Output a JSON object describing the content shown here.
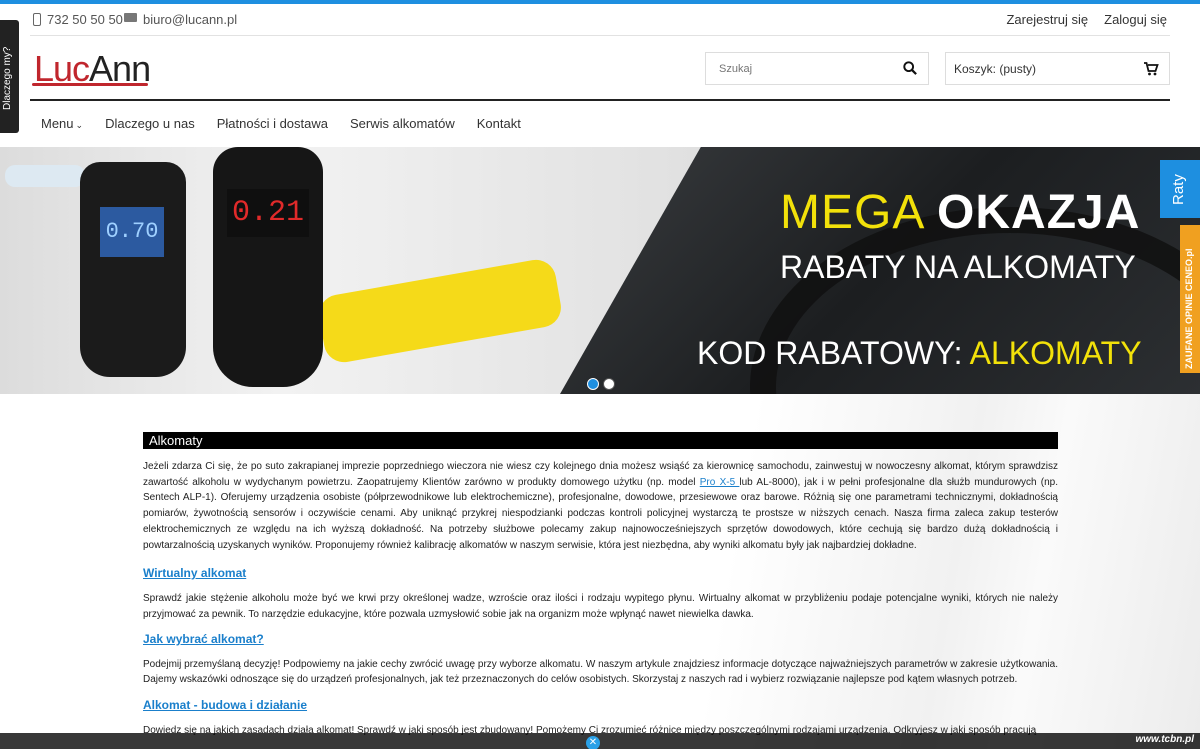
{
  "topbar": {
    "phone": "732 50 50 50",
    "email": "biuro@lucann.pl",
    "register": "Zarejestruj się",
    "login": "Zaloguj się"
  },
  "side_tab": "Dlaczego my?",
  "logo": {
    "part1": "Luc",
    "part2": "Ann"
  },
  "search": {
    "placeholder": "Szukaj"
  },
  "cart": {
    "label": "Koszyk:",
    "value": "(pusty)"
  },
  "nav": {
    "menu": "Menu",
    "items": [
      "Dlaczego u nas",
      "Płatności i dostawa",
      "Serwis alkomatów",
      "Kontakt"
    ]
  },
  "banner": {
    "line1_a": "MEGA",
    "line1_b": "OKAZJA",
    "line2": "RABATY NA ALKOMATY",
    "line3_a": "KOD RABATOWY:",
    "line3_b": "ALKOMATY",
    "dev1_display": "0.70",
    "dev2_display": "0.21"
  },
  "raty": "Raty",
  "ceneo": "ZAUFANE OPINIE CENEO.pl",
  "content": {
    "heading": "Alkomaty",
    "intro_a": "Jeżeli zdarza Ci się, że po suto zakrapianej imprezie poprzedniego wieczora nie wiesz czy kolejnego dnia możesz wsiąść za kierownicę samochodu, zainwestuj w nowoczesny alkomat, którym sprawdzisz zawartość alkoholu w wydychanym powietrzu. Zaopatrujemy Klientów zarówno w produkty domowego użytku (np. model ",
    "intro_link": "Pro X-5 ",
    "intro_b": "lub AL-8000), jak i w pełni profesjonalne dla służb mundurowych (np. Sentech ALP-1). Oferujemy urządzenia osobiste (półprzewodnikowe lub elektrochemiczne), profesjonalne, dowodowe, przesiewowe oraz barowe. Różnią się one parametrami technicznymi, dokładnością pomiarów, żywotnością sensorów i oczywiście cenami. Aby uniknąć przykrej niespodzianki podczas kontroli policyjnej wystarczą te prostsze w niższych cenach. Nasza firma zaleca zakup testerów elektrochemicznych ze względu na ich wyższą dokładność. Na potrzeby służbowe polecamy zakup najnowocześniejszych sprzętów dowodowych, które cechują się bardzo dużą dokładnością i powtarzalnością uzyskanych wyników. Proponujemy również kalibrację alkomatów w naszym serwisie, która jest niezbędna, aby wyniki alkomatu były jak najbardziej dokładne.",
    "sections": [
      {
        "title": "Wirtualny alkomat",
        "text": "Sprawdź jakie stężenie alkoholu może być we krwi przy określonej wadze, wzroście oraz ilości i rodzaju wypitego płynu. Wirtualny alkomat w przybliżeniu podaje potencjalne wyniki, których nie należy przyjmować za pewnik. To narzędzie edukacyjne, które pozwala uzmysłowić sobie jak na organizm może wpłynąć nawet niewielka dawka."
      },
      {
        "title": "Jak wybrać alkomat?",
        "text": "Podejmij przemyślaną decyzję! Podpowiemy na jakie cechy zwrócić uwagę przy wyborze alkomatu. W naszym artykule znajdziesz informacje dotyczące najważniejszych parametrów w zakresie użytkowania. Dajemy wskazówki odnoszące się do urządzeń profesjonalnych, jak też przeznaczonych do celów osobistych. Skorzystaj z naszych rad i wybierz rozwiązanie najlepsze pod kątem własnych potrzeb."
      },
      {
        "title": "Alkomat - budowa i działanie",
        "text": "Dowiedz się na jakich zasadach działa alkomat! Sprawdź w jaki sposób jest zbudowany! Pomożemy Ci zrozumieć różnice między poszczególnymi rodzajami urządzenia. Odkryjesz w jaki sposób pracują"
      }
    ]
  },
  "watermark": "www.tcbn.pl"
}
